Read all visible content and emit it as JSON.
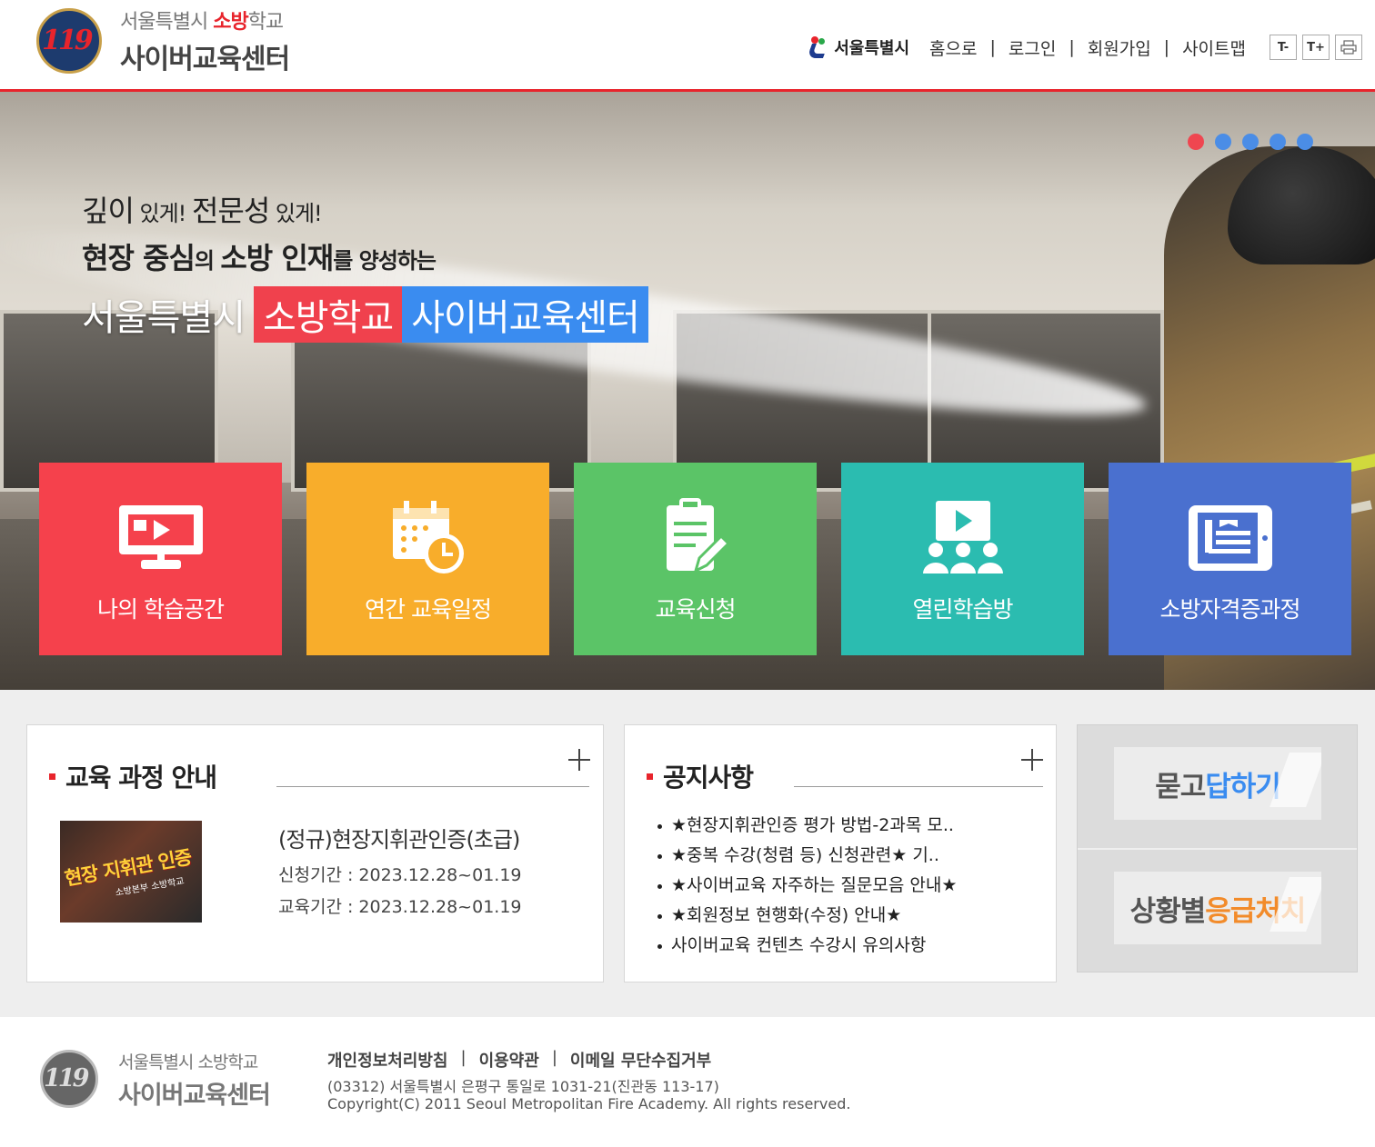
{
  "header": {
    "logo_line1_prefix": "서울특별시 ",
    "logo_line1_accent": "소방",
    "logo_line1_suffix": "학교",
    "logo_line2": "사이버교육센터",
    "logo_badge": "119",
    "seoul_label": "서울특별시",
    "nav": [
      "홈으로",
      "로그인",
      "회원가입",
      "사이트맵"
    ],
    "separator": "|",
    "font_decrease": "T-",
    "font_increase": "T+",
    "print_icon": "printer-icon"
  },
  "hero": {
    "line1_a": "깊이",
    "line1_b": " 있게! ",
    "line1_c": "전문성",
    "line1_d": " 있게!",
    "line2_a": "현장 중심",
    "line2_b": "의 ",
    "line2_c": "소방 인재",
    "line2_d": "를 양성하는",
    "line3_white": "서울특별시",
    "line3_red": "소방학교",
    "line3_blue": "사이버교육센터",
    "slides_total": 5,
    "active_slide": 1
  },
  "tiles": [
    {
      "label": "나의 학습공간",
      "icon": "video-monitor-icon",
      "color": "#f5414c"
    },
    {
      "label": "연간 교육일정",
      "icon": "calendar-clock-icon",
      "color": "#f8ad2b"
    },
    {
      "label": "교육신청",
      "icon": "clipboard-pencil-icon",
      "color": "#5bc467"
    },
    {
      "label": "열린학습방",
      "icon": "group-video-icon",
      "color": "#2bbcb0"
    },
    {
      "label": "소방자격증과정",
      "icon": "tablet-document-icon",
      "color": "#4a70cf"
    }
  ],
  "course_panel": {
    "title": "교육 과정 안내",
    "image_caption": "현장 지휘관 인증",
    "image_subcaption": "소방본부 소방학교",
    "course_title": "(정규)현장지휘관인증(초급)",
    "apply_period": "신청기간 : 2023.12.28~01.19",
    "edu_period": "교육기간 : 2023.12.28~01.19"
  },
  "notice_panel": {
    "title": "공지사항",
    "items": [
      "★현장지휘관인증 평가 방법-2과목 모..",
      "★중복 수강(청렴 등) 신청관련★ 기..",
      "★사이버교육 자주하는 질문모음 안내★",
      "★회원정보 현행화(수정) 안내★",
      "사이버교육 컨텐츠 수강시 유의사항"
    ]
  },
  "quick": {
    "qa_gray": "묻고",
    "qa_blue": "답하기",
    "aid_gray": "상황별",
    "aid_orange": "응급처치"
  },
  "footer": {
    "logo_line1": "서울특별시 소방학교",
    "logo_line2": "사이버교육센터",
    "links": [
      "개인정보처리방침",
      "이용약관",
      "이메일 무단수집거부"
    ],
    "address": "(03312) 서울특별시 은평구 통일로 1031-21(진관동 113-17)",
    "copyright": "Copyright(C) 2011 Seoul Metropolitan Fire Academy. All rights reserved."
  }
}
